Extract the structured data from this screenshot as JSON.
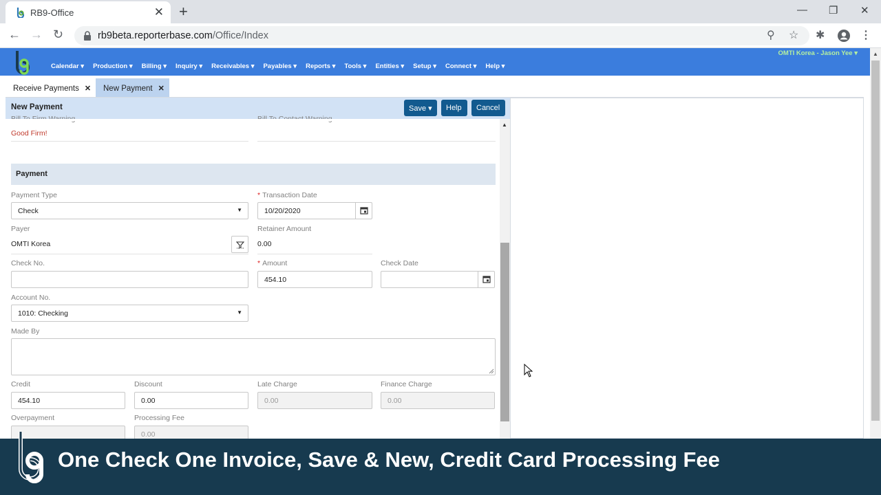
{
  "browser": {
    "tab_title": "RB9-Office",
    "url_host": "rb9beta.reporterbase.com",
    "url_path": "/Office/Index"
  },
  "app": {
    "menu": [
      {
        "label": "Calendar ▾"
      },
      {
        "label": "Production ▾"
      },
      {
        "label": "Billing ▾"
      },
      {
        "label": "Inquiry ▾"
      },
      {
        "label": "Receivables ▾"
      },
      {
        "label": "Payables ▾"
      },
      {
        "label": "Reports ▾"
      },
      {
        "label": "Tools ▾"
      },
      {
        "label": "Entities ▾"
      },
      {
        "label": "Setup ▾"
      },
      {
        "label": "Connect ▾"
      },
      {
        "label": "Help ▾"
      }
    ],
    "user": "OMTI Korea - Jason Yee ▾"
  },
  "tabs": [
    {
      "label": "Receive Payments",
      "close": "✕"
    },
    {
      "label": "New Payment",
      "close": "✕"
    }
  ],
  "panel": {
    "title": "New Payment",
    "save_label": "Save ▾",
    "help_label": "Help",
    "cancel_label": "Cancel"
  },
  "form": {
    "bill_to_firm_warning_label": "Bill To Firm Warning",
    "bill_to_firm_warning_value": "Good Firm!",
    "bill_to_contact_warning_label": "Bill To Contact Warning",
    "section_title": "Payment",
    "payment_type_label": "Payment Type",
    "payment_type_value": "Check",
    "transaction_date_label": "Transaction Date",
    "transaction_date_value": "10/20/2020",
    "payer_label": "Payer",
    "payer_value": "OMTI Korea",
    "retainer_amount_label": "Retainer Amount",
    "retainer_amount_value": "0.00",
    "check_no_label": "Check No.",
    "check_no_value": "",
    "amount_label": "Amount",
    "amount_value": "454.10",
    "check_date_label": "Check Date",
    "check_date_value": "",
    "account_no_label": "Account No.",
    "account_no_value": "1010: Checking",
    "made_by_label": "Made By",
    "credit_label": "Credit",
    "credit_value": "454.10",
    "discount_label": "Discount",
    "discount_value": "0.00",
    "late_charge_label": "Late Charge",
    "late_charge_value": "0.00",
    "finance_charge_label": "Finance Charge",
    "finance_charge_value": "0.00",
    "overpayment_label": "Overpayment",
    "processing_fee_label": "Processing Fee",
    "processing_fee_value": "0.00"
  },
  "banner": {
    "text": "One Check One Invoice, Save & New, Credit Card Processing Fee"
  },
  "colors": {
    "app_bar": "#3b7ddd",
    "panel_header": "#d2e2f5",
    "button": "#125a8f",
    "banner": "#173a4f",
    "warning_text": "#c0392b"
  }
}
